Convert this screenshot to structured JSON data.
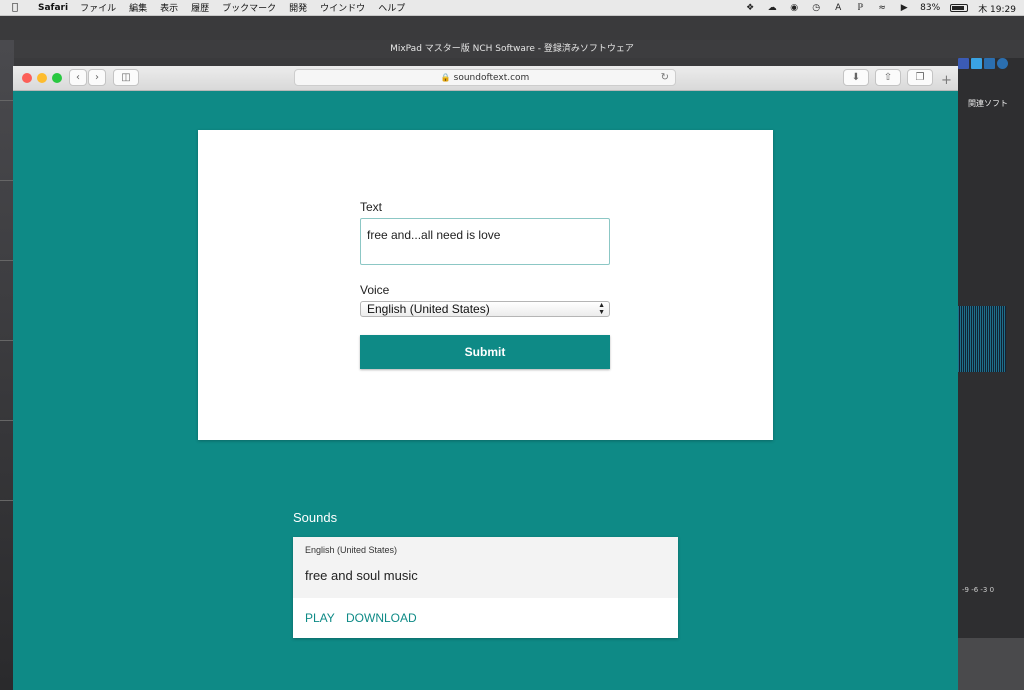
{
  "menubar": {
    "app_name": "Safari",
    "items": [
      "ファイル",
      "編集",
      "表示",
      "履歴",
      "ブックマーク",
      "開発",
      "ウインドウ",
      "ヘルプ"
    ],
    "battery": "83%",
    "clock": "木 19:29",
    "status_icons": [
      "dropbox-icon",
      "cloud-icon",
      "creative-cloud-icon",
      "time-machine-icon",
      "input-source-icon",
      "bluetooth-icon",
      "wifi-icon",
      "volume-icon",
      "battery-icon"
    ]
  },
  "background_window": {
    "title": "MixPad マスター版 NCH Software - 登録済みソフトウェア",
    "right_panel_label": "関連ソフト",
    "meter_labels": "-9  -6  -3  0"
  },
  "safari": {
    "url": "soundoftext.com"
  },
  "form": {
    "text_label": "Text",
    "text_value": "free and...all need is love",
    "voice_label": "Voice",
    "voice_selected": "English (United States)",
    "submit_label": "Submit"
  },
  "sounds": {
    "title": "Sounds",
    "items": [
      {
        "voice": "English (United States)",
        "text": "free and soul music",
        "play_label": "PLAY",
        "download_label": "DOWNLOAD"
      }
    ]
  },
  "colors": {
    "accent": "#0e8a86",
    "page_bg": "#0e8a86",
    "card_bg": "#ffffff"
  }
}
